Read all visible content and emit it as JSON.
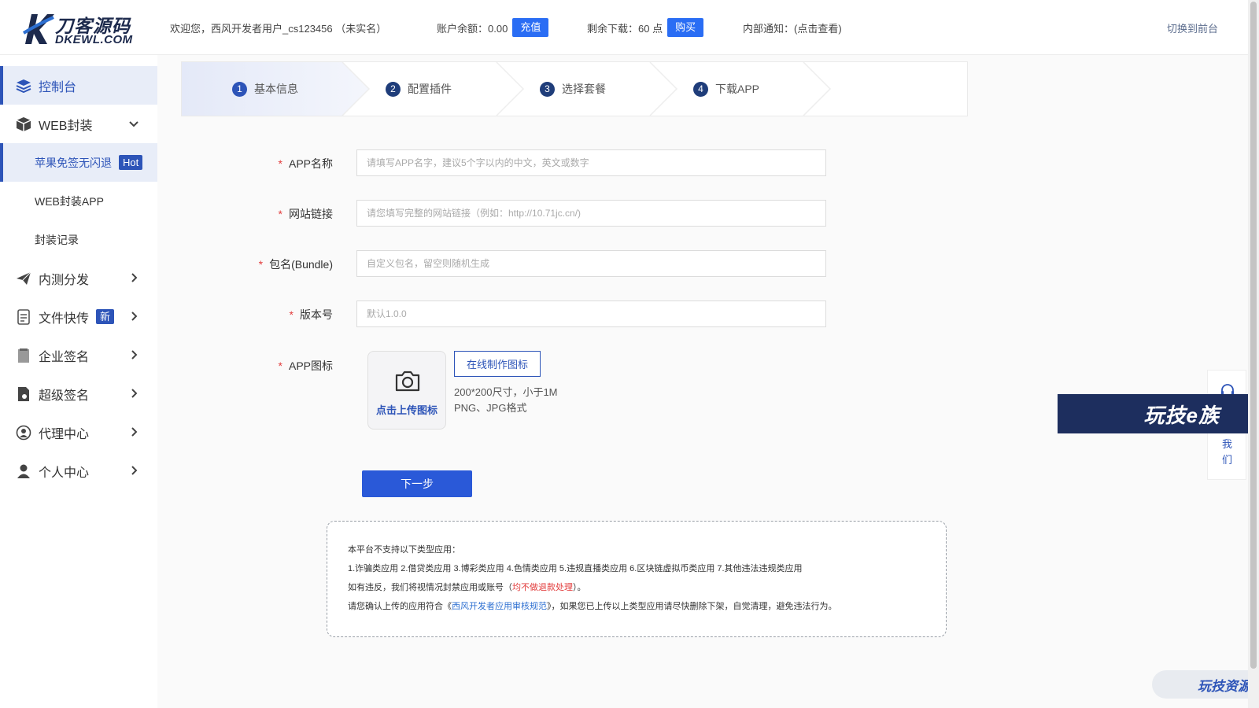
{
  "header": {
    "logo_cn": "刀客源码",
    "logo_en": "DKEWL.COM",
    "welcome": "欢迎您，西风开发者用户_cs123456 （未实名）",
    "balance_label": "账户余额：0.00",
    "recharge_label": "充值",
    "downloads_label": "剩余下载：60 点",
    "buy_label": "购买",
    "notice_label": "内部通知：(点击查看)",
    "switch_label": "切换到前台"
  },
  "sidebar": {
    "items": [
      {
        "label": "控制台",
        "icon": "layers-icon"
      },
      {
        "label": "WEB封装",
        "icon": "box-icon"
      },
      {
        "label": "内测分发",
        "icon": "paper-plane-icon"
      },
      {
        "label": "文件快传",
        "icon": "file-icon",
        "badge": "新"
      },
      {
        "label": "企业签名",
        "icon": "document-icon"
      },
      {
        "label": "超级签名",
        "icon": "seal-icon"
      },
      {
        "label": "代理中心",
        "icon": "agent-icon"
      },
      {
        "label": "个人中心",
        "icon": "user-icon"
      }
    ],
    "sub_items": [
      {
        "label": "苹果免签无闪退",
        "badge": "Hot"
      },
      {
        "label": "WEB封装APP"
      },
      {
        "label": "封装记录"
      }
    ]
  },
  "steps": [
    {
      "num": "1",
      "label": "基本信息"
    },
    {
      "num": "2",
      "label": "配置插件"
    },
    {
      "num": "3",
      "label": "选择套餐"
    },
    {
      "num": "4",
      "label": "下载APP"
    }
  ],
  "form": {
    "required_mark": "*",
    "app_name": {
      "label": "APP名称",
      "placeholder": "请填写APP名字，建议5个字以内的中文，英文或数字"
    },
    "site_url": {
      "label": "网站链接",
      "placeholder": "请您填写完整的网站链接（例如：http://10.71jc.cn/)"
    },
    "bundle": {
      "label": "包名(Bundle)",
      "placeholder": "自定义包名，留空则随机生成"
    },
    "version": {
      "label": "版本号",
      "placeholder": "默认1.0.0"
    },
    "icon": {
      "label": "APP图标",
      "upload_text": "点击上传图标",
      "make_button": "在线制作图标",
      "hint_size": "200*200尺寸，小于1M",
      "hint_format": "PNG、JPG格式"
    },
    "next_button": "下一步"
  },
  "notice": {
    "line1": "本平台不支持以下类型应用：",
    "line2": "1.诈骗类应用 2.借贷类应用 3.博彩类应用 4.色情类应用 5.违规直播类应用 6.区块链虚拟币类应用 7.其他违法违规类应用",
    "line3_a": "如有违反，我们将视情况封禁应用或账号（",
    "line3_red": "均不做退款处理",
    "line3_b": "）。",
    "line4_a": "请您确认上传的应用符合《",
    "line4_link": "西风开发者应用审核规范",
    "line4_b": "》，如果您已上传以上类型应用请尽快删除下架，自觉清理，避免违法行为。"
  },
  "float": {
    "contact_text": "我们",
    "watermark_banner": "玩技e族",
    "watermark_bottom": "玩技资源"
  }
}
